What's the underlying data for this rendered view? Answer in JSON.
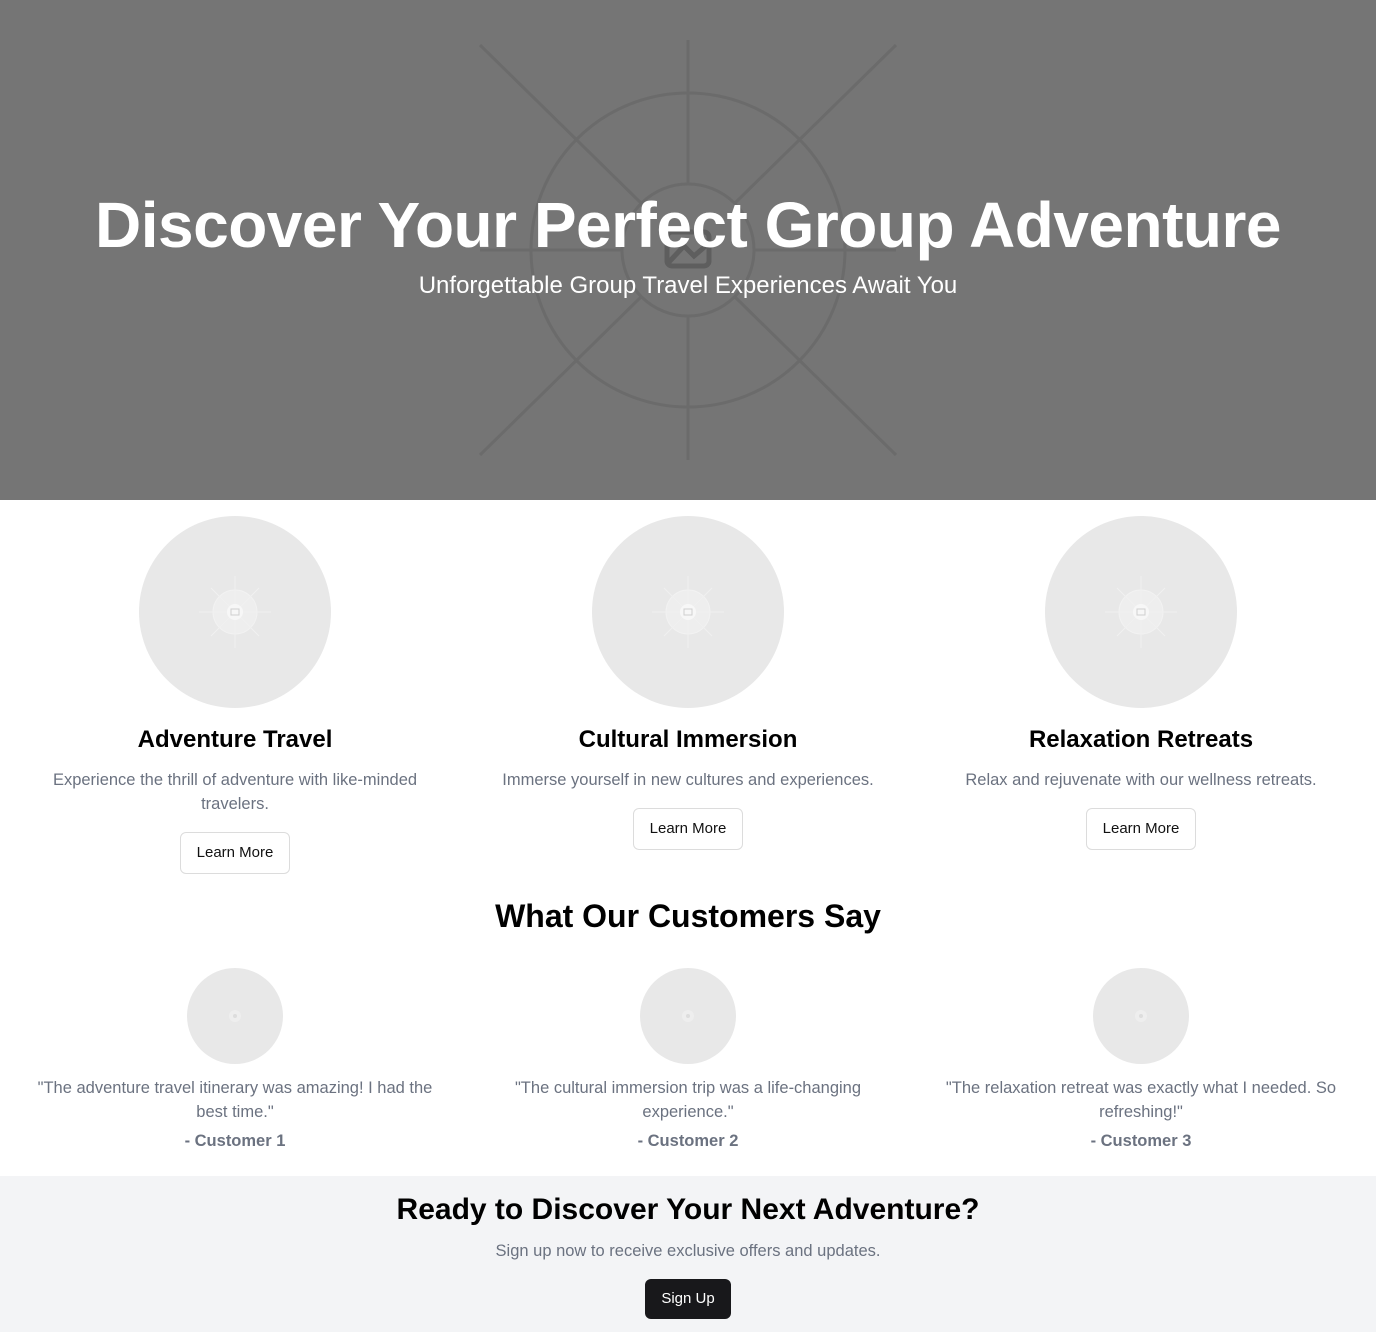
{
  "hero": {
    "title": "Discover Your Perfect Group Adventure",
    "subtitle": "Unforgettable Group Travel Experiences Await You",
    "background_icon": "image-placeholder-icon"
  },
  "services": [
    {
      "title": "Adventure Travel",
      "description": "Experience the thrill of adventure with like-minded travelers.",
      "button": "Learn More"
    },
    {
      "title": "Cultural Immersion",
      "description": "Immerse yourself in new cultures and experiences.",
      "button": "Learn More"
    },
    {
      "title": "Relaxation Retreats",
      "description": "Relax and rejuvenate with our wellness retreats.",
      "button": "Learn More"
    }
  ],
  "testimonials": {
    "title": "What Our Customers Say",
    "items": [
      {
        "quote": "\"The adventure travel itinerary was amazing! I had the best time.\"",
        "author": "- Customer 1"
      },
      {
        "quote": "\"The cultural immersion trip was a life-changing experience.\"",
        "author": "- Customer 2"
      },
      {
        "quote": "\"The relaxation retreat was exactly what I needed. So refreshing!\"",
        "author": "- Customer 3"
      }
    ]
  },
  "cta": {
    "title": "Ready to Discover Your Next Adventure?",
    "subtitle": "Sign up now to receive exclusive offers and updates.",
    "button": "Sign Up"
  },
  "colors": {
    "hero_bg": "#757575",
    "placeholder_bg": "#e8e8e8",
    "muted_text": "#6b7280",
    "cta_bg": "#f3f4f6",
    "dark_button": "#18181b"
  }
}
